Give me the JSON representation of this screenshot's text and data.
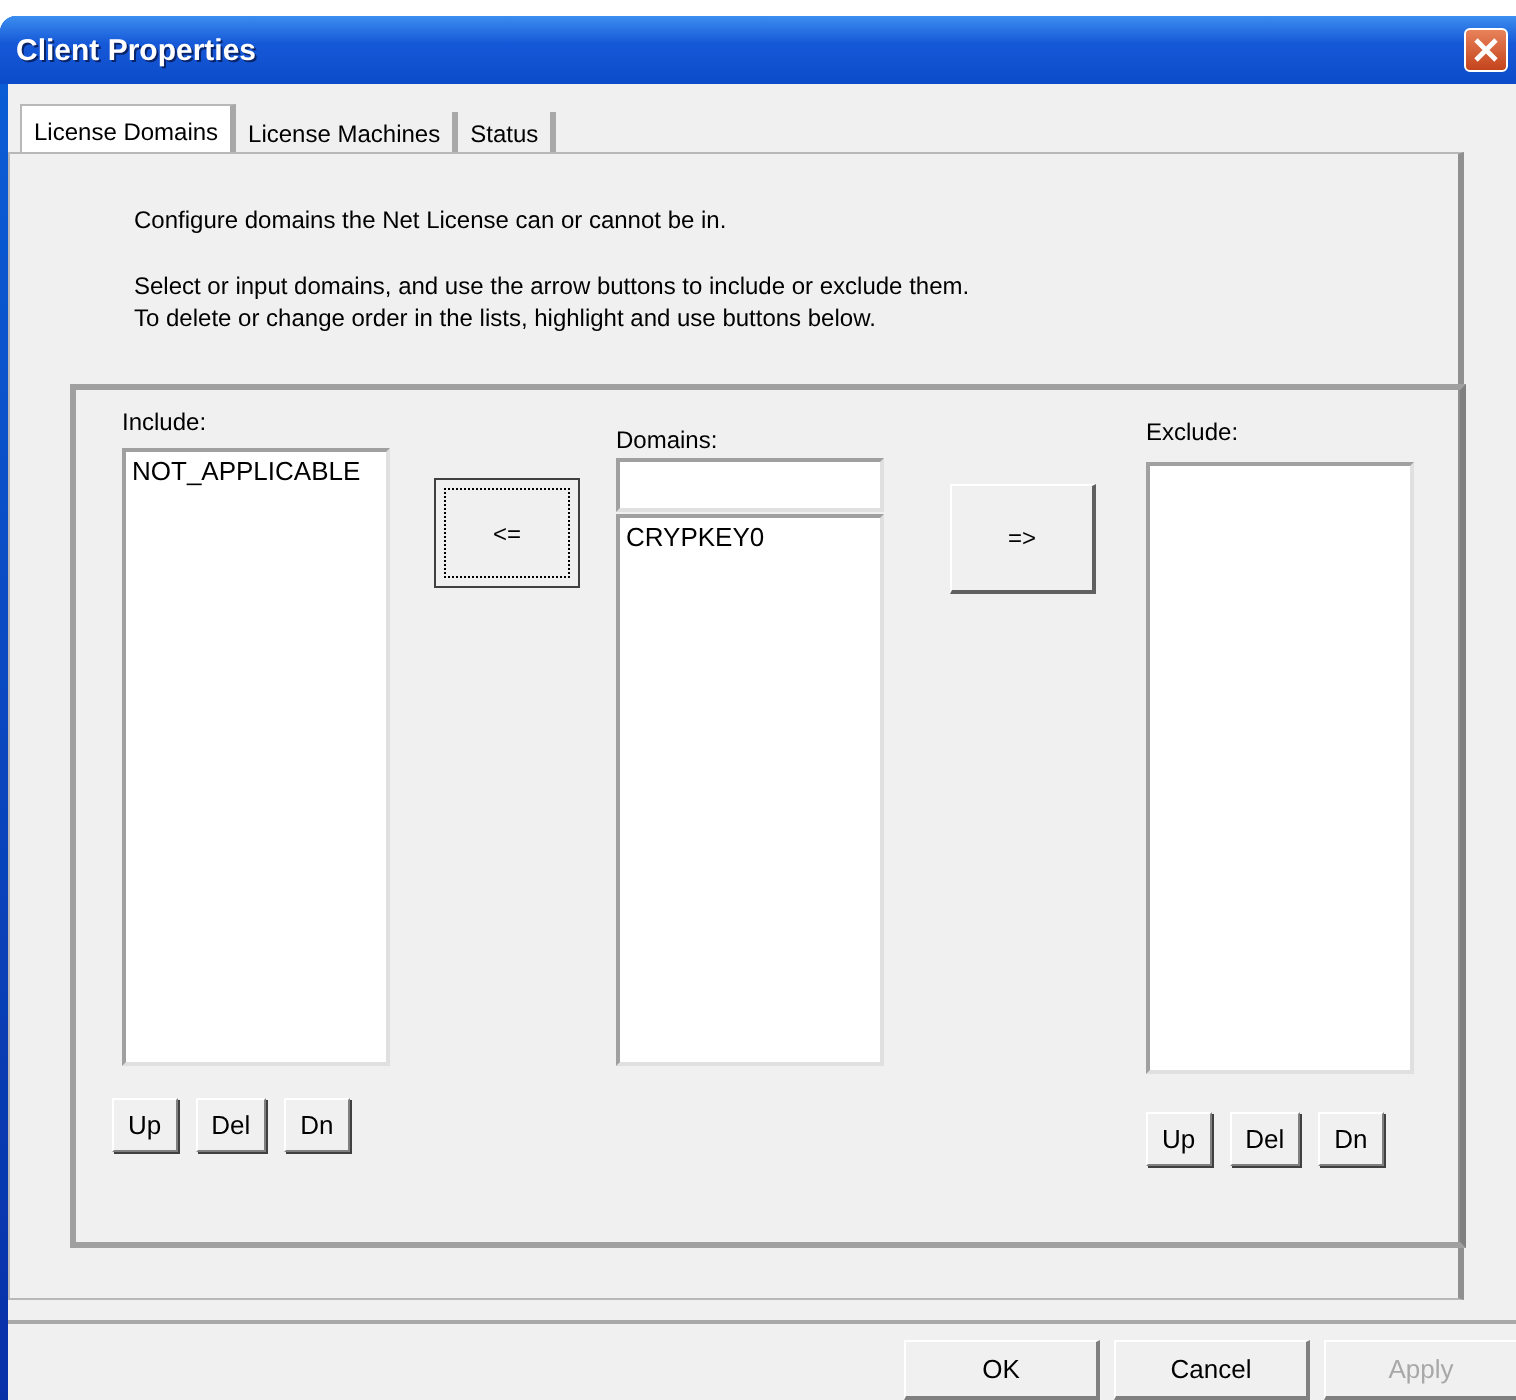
{
  "window": {
    "title": "Client Properties"
  },
  "tabs": [
    {
      "label": "License Domains",
      "selected": true
    },
    {
      "label": "License Machines",
      "selected": false
    },
    {
      "label": "Status",
      "selected": false
    }
  ],
  "description": [
    "Configure domains the Net License can or cannot be in.",
    "Select or input domains, and use the arrow buttons to include or exclude them.",
    "To delete or change order in the lists, highlight and use buttons below."
  ],
  "include": {
    "label": "Include:",
    "items": [
      "NOT_APPLICABLE"
    ],
    "buttons": [
      "Up",
      "Del",
      "Dn"
    ]
  },
  "move_to_include": {
    "label": "<=",
    "focused": true
  },
  "domains": {
    "label": "Domains:",
    "items": [
      "CRYPKEY0"
    ]
  },
  "move_to_exclude": {
    "label": "=>",
    "focused": false
  },
  "exclude": {
    "label": "Exclude:",
    "buttons": [
      "Up",
      "Del",
      "Dn"
    ]
  },
  "footer_buttons": [
    {
      "label": "OK",
      "disabled": false
    },
    {
      "label": "Cancel",
      "disabled": false
    },
    {
      "label": "Apply",
      "disabled": true
    }
  ]
}
